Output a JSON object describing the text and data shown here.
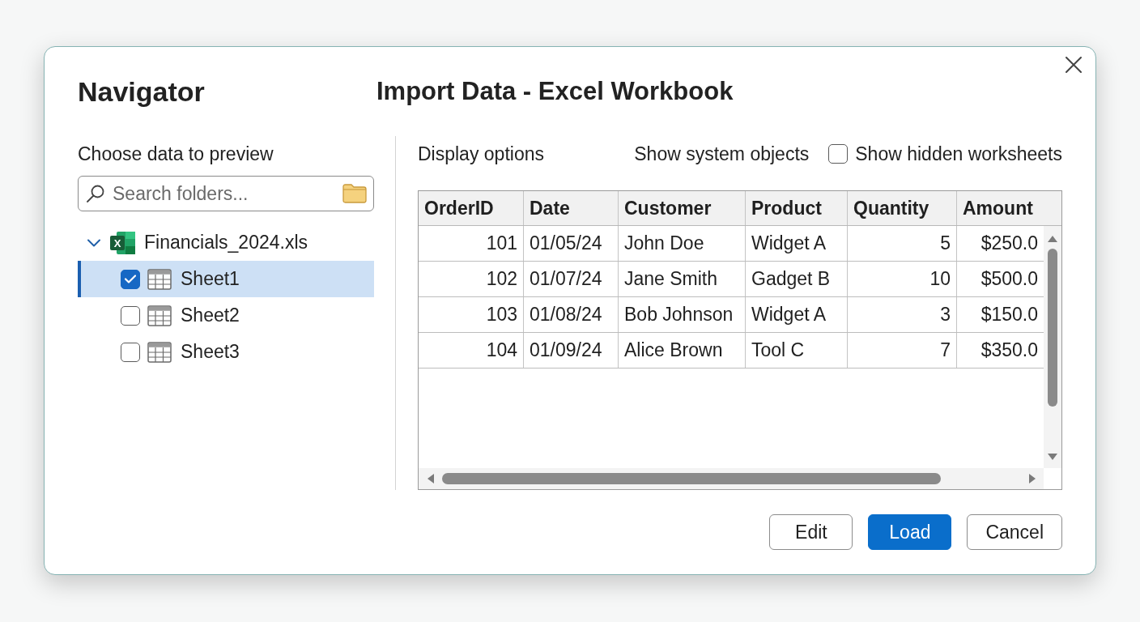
{
  "window": {
    "title": "Navigator",
    "subtitle": "Import Data - Excel Workbook"
  },
  "navigator": {
    "heading": "Choose data to preview",
    "search": {
      "placeholder": "Search folders..."
    },
    "tree": [
      {
        "label": "Financials_2024.xls",
        "kind": "workbook",
        "icon_text": "X",
        "expanded": true,
        "children": [
          {
            "label": "Sheet1",
            "kind": "sheet",
            "checked": true,
            "selected": true
          },
          {
            "label": "Sheet2",
            "kind": "sheet",
            "checked": false,
            "selected": false
          },
          {
            "label": "Sheet3",
            "kind": "sheet",
            "checked": false,
            "selected": false
          }
        ]
      }
    ]
  },
  "preview": {
    "label": "Display options",
    "options": [
      {
        "label": "Show system objects",
        "kind": "text"
      },
      {
        "label": "Show hidden worksheets",
        "kind": "checkbox",
        "checked": false
      }
    ],
    "table": {
      "columns": [
        {
          "label": "OrderID",
          "numeric": true
        },
        {
          "label": "Date",
          "numeric": false
        },
        {
          "label": "Customer",
          "numeric": false
        },
        {
          "label": "Product",
          "numeric": false
        },
        {
          "label": "Quantity",
          "numeric": true
        },
        {
          "label": "Amount",
          "numeric": true
        }
      ],
      "rows": [
        [
          "101",
          "01/05/24",
          "John Doe",
          "Widget A",
          "5",
          "$250.0"
        ],
        [
          "102",
          "01/07/24",
          "Jane Smith",
          "Gadget B",
          "10",
          "$500.0"
        ],
        [
          "103",
          "01/08/24",
          "Bob Johnson",
          "Widget A",
          "3",
          "$150.0"
        ],
        [
          "104",
          "01/09/24",
          "Alice Brown",
          "Tool C",
          "7",
          "$350.0"
        ]
      ]
    }
  },
  "buttons": [
    {
      "label": "Edit",
      "kind": "secondary"
    },
    {
      "label": "Load",
      "kind": "primary"
    },
    {
      "label": "Cancel",
      "kind": "secondary"
    }
  ]
}
